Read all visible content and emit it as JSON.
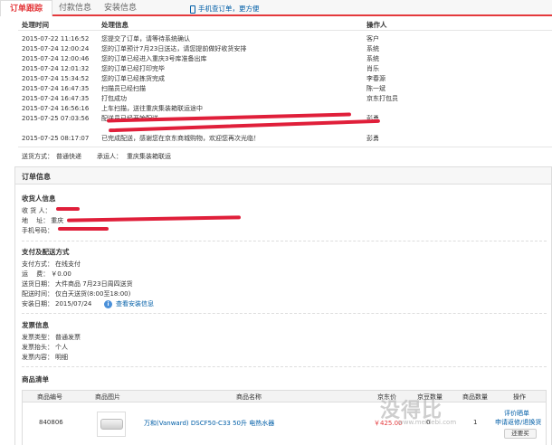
{
  "tabs": [
    {
      "label": "订单跟踪"
    },
    {
      "label": "付款信息"
    },
    {
      "label": "安装信息"
    }
  ],
  "phone_link": "手机查订单，更方便",
  "tracking": {
    "headers": {
      "time": "处理时间",
      "info": "处理信息",
      "operator": "操作人"
    },
    "rows": [
      {
        "time": "2015-07-22 11:16:52",
        "info": "您提交了订单，请等待系统确认",
        "operator": "客户"
      },
      {
        "time": "2015-07-24 12:00:24",
        "info": "您的订单预计7月23日送达，请您提前做好收货安排",
        "operator": "系统"
      },
      {
        "time": "2015-07-24 12:00:46",
        "info": "您的订单已经进入重庆3号库准备出库",
        "operator": "系统"
      },
      {
        "time": "2015-07-24 12:01:32",
        "info": "您的订单已经打印完毕",
        "operator": "肖乐"
      },
      {
        "time": "2015-07-24 15:34:52",
        "info": "您的订单已经拣货完成",
        "operator": "李春源"
      },
      {
        "time": "2015-07-24 16:47:35",
        "info": "扫描员已经扫描",
        "operator": "陈一斌"
      },
      {
        "time": "2015-07-24 16:47:35",
        "info": "打包成功",
        "operator": "京东打包员"
      },
      {
        "time": "2015-07-24 16:56:16",
        "info": "上车扫描，送往重庆集装箱联运途中",
        "operator": ""
      },
      {
        "time": "2015-07-25 07:03:56",
        "info": "配送员已经开始配送",
        "operator": "彭勇"
      },
      {
        "time": "2015-07-25 08:17:07",
        "info": "已完成配送，感谢您在京东商城购物，欢迎您再次光临！",
        "operator": "彭勇"
      }
    ],
    "ship_method_label": "送货方式：",
    "ship_method": "普通快递",
    "carrier_label": "承运人：",
    "carrier": "重庆集装箱联运"
  },
  "order_info": {
    "title": "订单信息",
    "receiver": {
      "title": "收货人信息",
      "name_label": "收 货 人：",
      "address_label": "地　 址：",
      "address_prefix": "重庆",
      "phone_label": "手机号码："
    },
    "payment": {
      "title": "支付及配送方式",
      "items": [
        {
          "label": "支付方式：",
          "value": "在线支付"
        },
        {
          "label": "运　 费：",
          "value": "￥0.00"
        },
        {
          "label": "送货日期：",
          "value": "大件商品  7月23日周四送货"
        },
        {
          "label": "配送时间：",
          "value": "仅白天送货(8:00至18:00)"
        },
        {
          "label": "安装日期：",
          "value": "2015/07/24"
        }
      ],
      "install_link": "查看安装信息"
    },
    "invoice": {
      "title": "发票信息",
      "items": [
        {
          "label": "发票类型：",
          "value": "普通发票"
        },
        {
          "label": "发票抬头：",
          "value": "个人"
        },
        {
          "label": "发票内容：",
          "value": "明细"
        }
      ]
    },
    "products": {
      "title": "商品清单",
      "headers": {
        "id": "商品编号",
        "image": "商品图片",
        "name": "商品名称",
        "price": "京东价",
        "points": "京豆数量",
        "qty": "商品数量",
        "action": "操作"
      },
      "rows": [
        {
          "id": "840806",
          "name": "万和(Vanward) DSCF50-C33 50升 电热水器",
          "price": "￥425.00",
          "points": "0",
          "qty": "1",
          "review": "评价晒单",
          "install": "申请返修/退换货",
          "buy_again": "还要买"
        }
      ]
    }
  },
  "watermark": {
    "text": "没得比",
    "sub": "www.meidebi.com"
  },
  "colors": {
    "accent": "#e4393c",
    "link": "#005ea7"
  }
}
